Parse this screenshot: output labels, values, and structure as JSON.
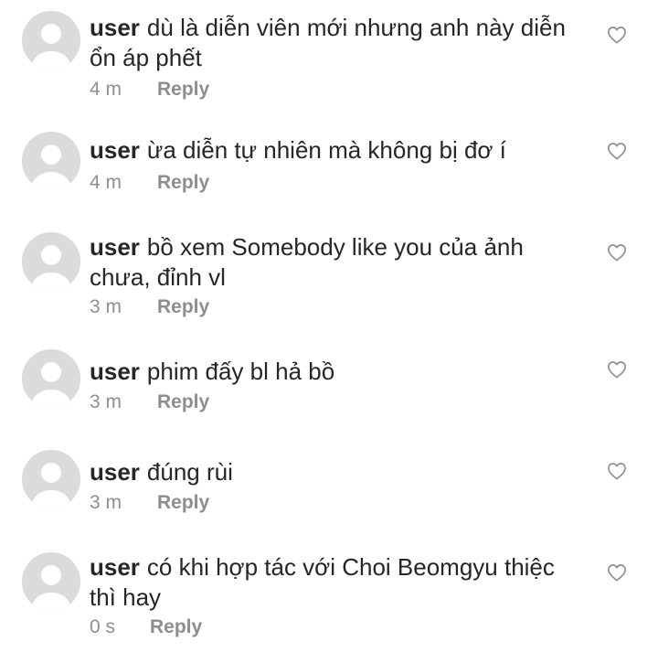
{
  "comments": [
    {
      "username": "user",
      "text": "dù là diễn viên mới nhưng anh này diễn ổn áp phết",
      "time": "4 m",
      "reply_label": "Reply"
    },
    {
      "username": "user",
      "text": "ừa diễn tự nhiên mà không bị đơ í",
      "time": "4 m",
      "reply_label": "Reply"
    },
    {
      "username": "user",
      "text": "bồ xem Somebody like you của ảnh chưa, đỉnh vl",
      "time": "3 m",
      "reply_label": "Reply"
    },
    {
      "username": "user",
      "text": "phim đấy bl hả bồ",
      "time": "3 m",
      "reply_label": "Reply"
    },
    {
      "username": "user",
      "text": "đúng rùi",
      "time": "3 m",
      "reply_label": "Reply"
    },
    {
      "username": "user",
      "text": "có khi hợp tác với Choi Beomgyu thiệc thì hay",
      "time": "0 s",
      "reply_label": "Reply"
    }
  ],
  "icons": {
    "avatar": "default-avatar-icon",
    "like": "heart-outline-icon"
  },
  "colors": {
    "text": "#262626",
    "secondary": "#8e8e8e",
    "avatar_bg": "#dbdbdb"
  }
}
